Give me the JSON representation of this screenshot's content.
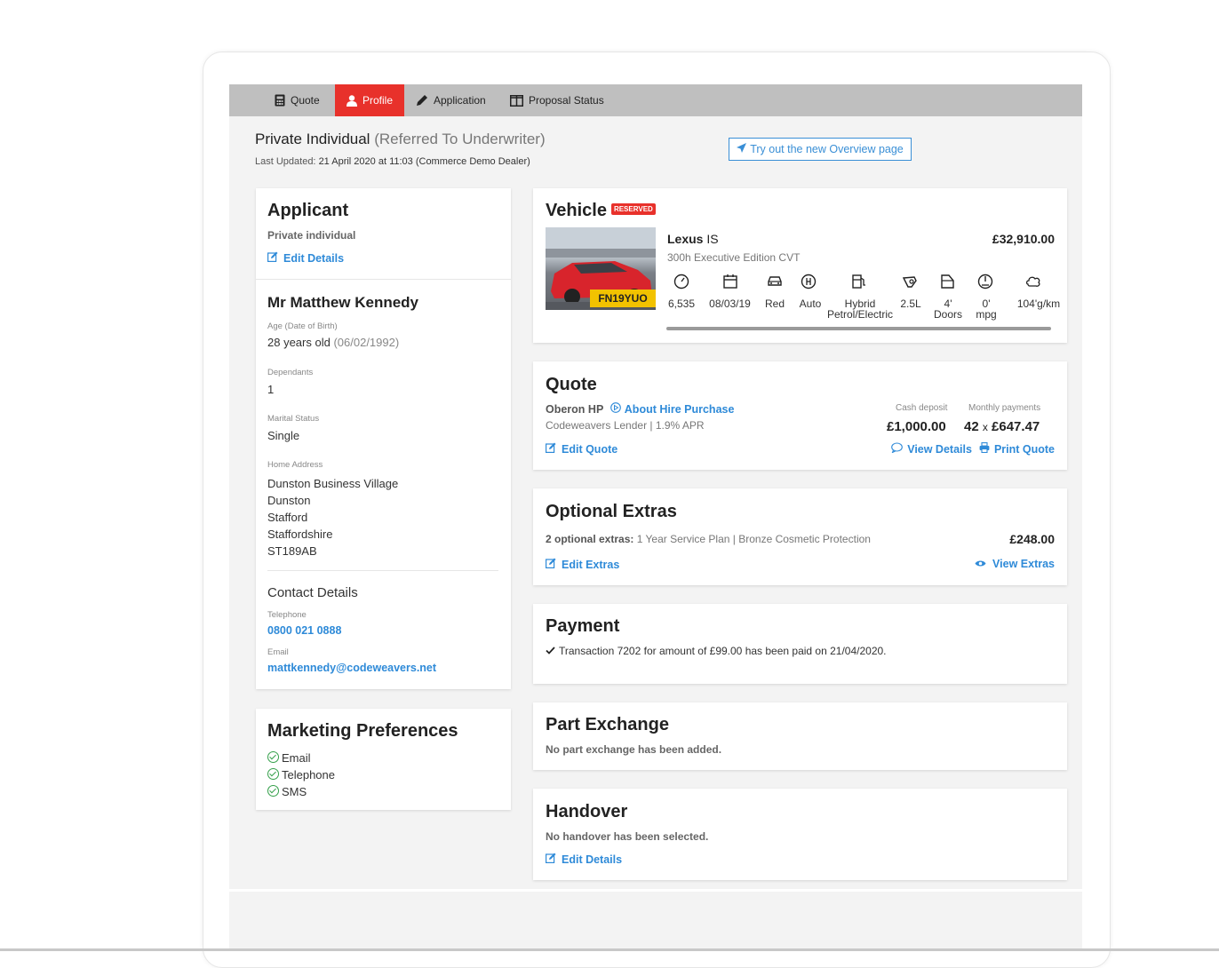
{
  "tabs": [
    {
      "label": "Quote",
      "icon": "calculator-icon"
    },
    {
      "label": "Profile",
      "icon": "user-icon"
    },
    {
      "label": "Application",
      "icon": "pen-icon"
    },
    {
      "label": "Proposal Status",
      "icon": "columns-icon"
    }
  ],
  "header": {
    "title": "Private Individual",
    "status": "(Referred To Underwriter)",
    "updated_label": "Last Updated:",
    "updated_value": "21 April 2020 at 11:03 (Commerce Demo Dealer)",
    "try_button": "Try out the new Overview page"
  },
  "applicant": {
    "heading": "Applicant",
    "type": "Private individual",
    "edit": "Edit Details",
    "name": "Mr Matthew Kennedy",
    "age_label": "Age (Date of Birth)",
    "age_value": "28 years old",
    "dob": "(06/02/1992)",
    "dependants_label": "Dependants",
    "dependants_value": "1",
    "marital_label": "Marital Status",
    "marital_value": "Single",
    "address_label": "Home Address",
    "address_lines": [
      "Dunston Business Village",
      "Dunston",
      "Stafford",
      "Staffordshire",
      "ST189AB"
    ],
    "contact_heading": "Contact Details",
    "telephone_label": "Telephone",
    "telephone_value": "0800 021 0888",
    "email_label": "Email",
    "email_value": "mattkennedy@codeweavers.net"
  },
  "marketing": {
    "heading": "Marketing Preferences",
    "items": [
      "Email",
      "Telephone",
      "SMS"
    ]
  },
  "vehicle": {
    "heading": "Vehicle",
    "badge": "RESERVED",
    "make": "Lexus",
    "model": "IS",
    "price": "£32,910.00",
    "derivative": "300h Executive Edition CVT",
    "plate": "FN19YUO",
    "specs": [
      {
        "icon": "speedometer-icon",
        "value": "6,535"
      },
      {
        "icon": "calendar-icon",
        "value": "08/03/19"
      },
      {
        "icon": "car-icon",
        "value": "Red"
      },
      {
        "icon": "gearbox-icon",
        "value": "Auto"
      },
      {
        "icon": "fuel-pump-icon",
        "value": "Hybrid\nPetrol/Electric"
      },
      {
        "icon": "engine-icon",
        "value": "2.5L"
      },
      {
        "icon": "door-icon",
        "value": "4'\nDoors"
      },
      {
        "icon": "gauge-icon",
        "value": "0'\nmpg"
      },
      {
        "icon": "emissions-icon",
        "value": "104'g/km"
      }
    ]
  },
  "quote": {
    "heading": "Quote",
    "product": "Oberon HP",
    "about": "About Hire Purchase",
    "lender": "Codeweavers Lender | 1.9% APR",
    "deposit_label": "Cash deposit",
    "deposit_value": "£1,000.00",
    "monthly_label": "Monthly payments",
    "monthly_count": "42",
    "monthly_x": "x",
    "monthly_value": "£647.47",
    "edit": "Edit Quote",
    "view": "View Details",
    "print": "Print Quote"
  },
  "extras": {
    "heading": "Optional Extras",
    "count_label": "2 optional extras:",
    "list": "1 Year Service Plan | Bronze Cosmetic Protection",
    "total": "£248.00",
    "edit": "Edit Extras",
    "view": "View Extras"
  },
  "payment": {
    "heading": "Payment",
    "text": "Transaction 7202 for amount of £99.00 has been paid on 21/04/2020."
  },
  "part_exchange": {
    "heading": "Part Exchange",
    "text": "No part exchange has been added."
  },
  "handover": {
    "heading": "Handover",
    "text": "No handover has been selected.",
    "edit": "Edit Details"
  },
  "colors": {
    "accent": "#e8312b",
    "link": "#2e8ad8",
    "tabbar": "#bfbfbf",
    "background": "#f3f3f3",
    "check": "#35a04b",
    "plate": "#f2c200"
  }
}
